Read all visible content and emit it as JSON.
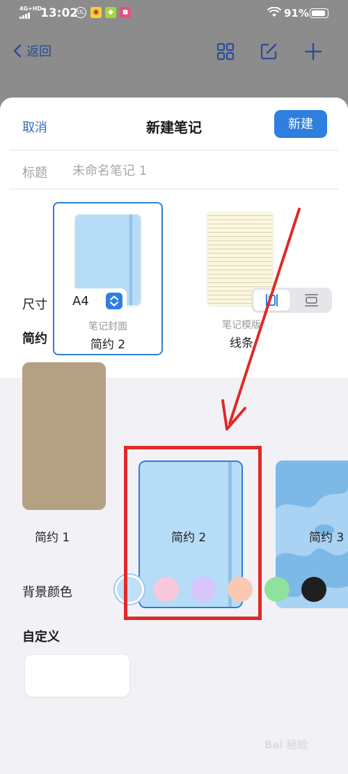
{
  "status_bar": {
    "network": "4G+HD",
    "time": "13:02",
    "battery": "91%",
    "battery_level": 0.91,
    "app_icons": [
      "ul-icon",
      "weibo-icon",
      "green-app-icon",
      "pink-app-icon"
    ]
  },
  "nav": {
    "back_label": "返回",
    "icons": [
      "grid-icon",
      "edit-icon",
      "plus-icon"
    ]
  },
  "sheet": {
    "cancel_label": "取消",
    "title": "新建笔记",
    "create_label": "新建",
    "name_label": "标题",
    "name_placeholder": "未命名笔记 1"
  },
  "options": [
    {
      "sub": "笔记封面",
      "name": "简约 2",
      "selected": true
    },
    {
      "sub": "笔记模版",
      "name": "线条",
      "selected": false
    }
  ],
  "size": {
    "label": "尺寸",
    "value": "A4",
    "orientation": "portrait"
  },
  "style_section": {
    "heading": "简约",
    "covers": [
      {
        "name": "简约 1",
        "color": "#b4a184"
      },
      {
        "name": "简约 2",
        "color": "#b6dcf7",
        "selected": true
      },
      {
        "name": "简约 3",
        "color": "#a9d2f3"
      }
    ]
  },
  "background": {
    "label": "背景颜色",
    "colors": [
      "#bfe0f8",
      "#f9c8dc",
      "#d7c6fb",
      "#fbc8b2",
      "#8ee29e",
      "#1f1f1f"
    ],
    "selected_index": 0
  },
  "custom_heading": "自定义",
  "watermark": "Bai 经验"
}
